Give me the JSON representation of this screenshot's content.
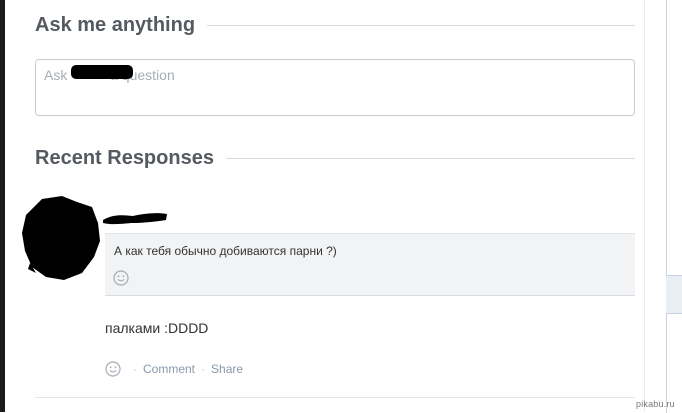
{
  "ask": {
    "heading": "Ask me anything",
    "placeholder": "Ask           a question"
  },
  "responses": {
    "heading": "Recent Responses",
    "items": [
      {
        "question": "А как тебя обычно добиваются парни ?)",
        "answer": "палками :DDDD",
        "actions": {
          "comment": "Comment",
          "share": "Share",
          "separator": "·"
        }
      }
    ]
  },
  "watermark": "pikabu.ru",
  "colors": {
    "heading": "#555a60",
    "link": "#8a98aa",
    "question_bg": "#f2f3f4"
  },
  "icons": [
    "smiley-icon",
    "smiley-icon"
  ]
}
